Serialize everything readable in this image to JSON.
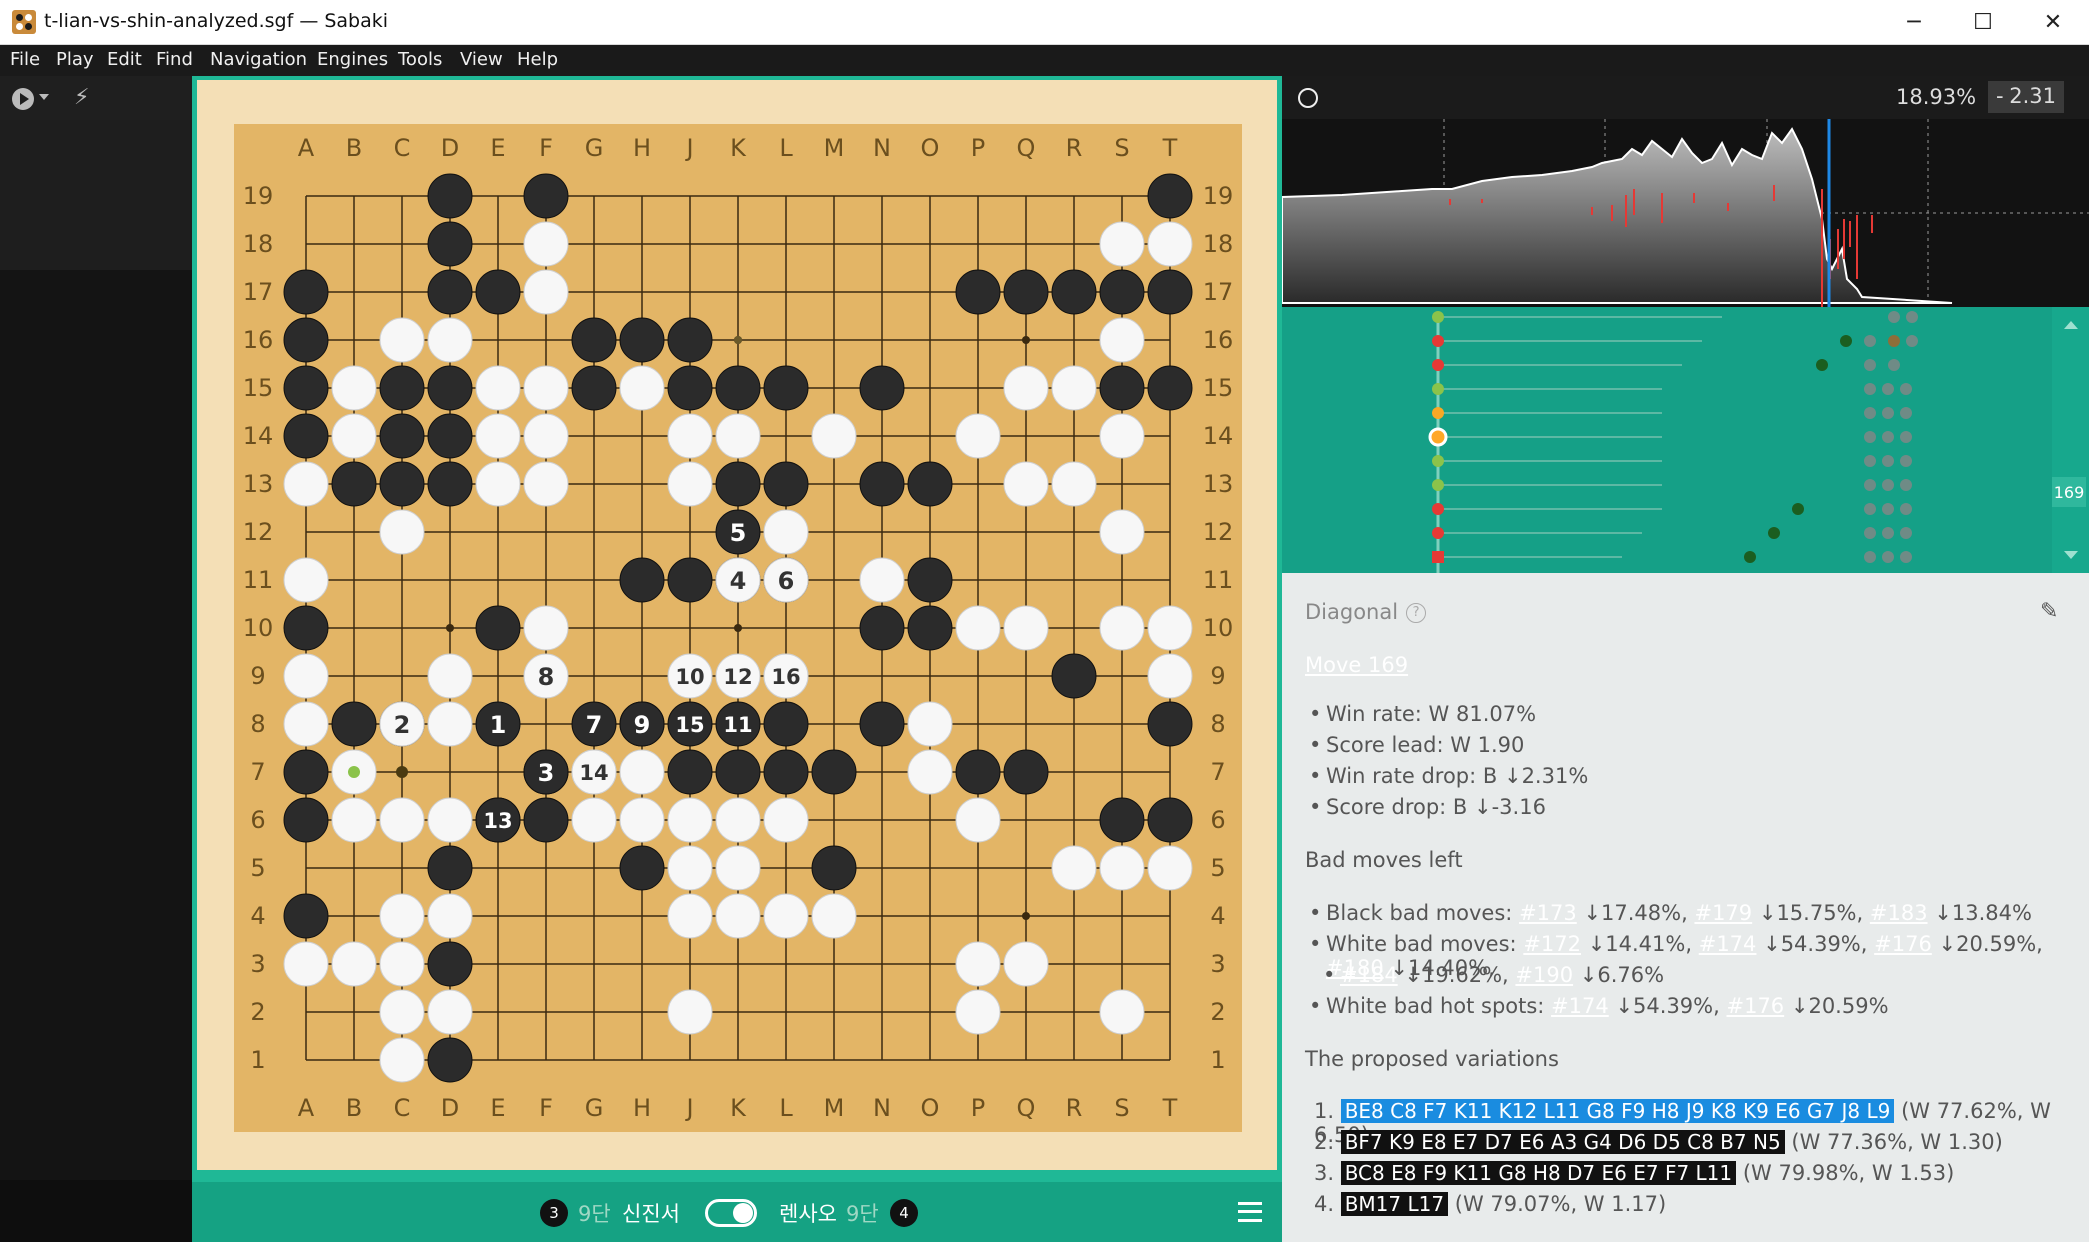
{
  "window": {
    "title": "t-lian-vs-shin-analyzed.sgf — Sabaki",
    "minimize": "─",
    "maximize": "☐",
    "close": "✕"
  },
  "menu": [
    "File",
    "Play",
    "Edit",
    "Find",
    "Navigation",
    "Engines",
    "Tools",
    "View",
    "Help"
  ],
  "toolbar": {
    "play_icon": "play-icon",
    "bolt_icon": "⚡"
  },
  "board": {
    "columns": [
      "A",
      "B",
      "C",
      "D",
      "E",
      "F",
      "G",
      "H",
      "J",
      "K",
      "L",
      "M",
      "N",
      "O",
      "P",
      "Q",
      "R",
      "S",
      "T"
    ],
    "rows": [
      "19",
      "18",
      "17",
      "16",
      "15",
      "14",
      "13",
      "12",
      "11",
      "10",
      "9",
      "8",
      "7",
      "6",
      "5",
      "4",
      "3",
      "2",
      "1"
    ],
    "stones": [
      "...B.B............B",
      "...B.W...........WW",
      "B..BBW........BBBBB",
      "B.WW..BBB........W.",
      "BWBBWWBWBBB.B..WWBB",
      "BWBBWW..WW.W..W..W.",
      "WBBBWW..WBB.BB.WW..",
      "..W......WW......W.",
      "W......BBBB.WB.....",
      "B...BW......BBWW.WW",
      "W..W......W.....B.W",
      "WBBWW..B..B.BW....B",
      "BW...BWWBBBB.WBB...",
      "BWWWBBWWWWW...W..BB",
      "...B...BWW.B....WWW",
      "B.WW....WWWW.......",
      "WWWB..........WW...",
      "..WW....W.....W..W.",
      "..WB..............."
    ],
    "numbered": [
      {
        "n": "1",
        "col": "E",
        "row": "8",
        "color": "B"
      },
      {
        "n": "2",
        "col": "C",
        "row": "8",
        "color": "W"
      },
      {
        "n": "3",
        "col": "F",
        "row": "7",
        "color": "B"
      },
      {
        "n": "4",
        "col": "K",
        "row": "11",
        "color": "W"
      },
      {
        "n": "5",
        "col": "K",
        "row": "12",
        "color": "B"
      },
      {
        "n": "6",
        "col": "L",
        "row": "11",
        "color": "W"
      },
      {
        "n": "7",
        "col": "G",
        "row": "8",
        "color": "B"
      },
      {
        "n": "8",
        "col": "F",
        "row": "9",
        "color": "W"
      },
      {
        "n": "9",
        "col": "H",
        "row": "8",
        "color": "B"
      },
      {
        "n": "10",
        "col": "J",
        "row": "9",
        "color": "W"
      },
      {
        "n": "11",
        "col": "K",
        "row": "8",
        "color": "B"
      },
      {
        "n": "12",
        "col": "K",
        "row": "9",
        "color": "W"
      },
      {
        "n": "13",
        "col": "E",
        "row": "6",
        "color": "B"
      },
      {
        "n": "14",
        "col": "G",
        "row": "7",
        "color": "W"
      },
      {
        "n": "15",
        "col": "J",
        "row": "8",
        "color": "B"
      },
      {
        "n": "16",
        "col": "L",
        "row": "9",
        "color": "W"
      }
    ]
  },
  "footer": {
    "black_captures": "3",
    "black_rank": "9단",
    "black_name": "신진서",
    "white_name": "렌사오",
    "white_rank": "9단",
    "white_captures": "4"
  },
  "analysis": {
    "winrate": "18.93%",
    "score_sign": "-",
    "score": "2.31"
  },
  "tree": {
    "move_counter": "169"
  },
  "comment": {
    "title": "Diagonal",
    "move_link": "Move 169",
    "stats": [
      "Win rate: W 81.07%",
      "Score lead: W 1.90",
      "Win rate drop: B ↓2.31%",
      "Score drop: B ↓-3.16"
    ],
    "bad_moves_heading": "Bad moves left",
    "black_label": "Black bad moves:",
    "black_moves": [
      {
        "m": "#173",
        "d": "↓17.48%"
      },
      {
        "m": "#179",
        "d": "↓15.75%"
      },
      {
        "m": "#183",
        "d": "↓13.84%"
      }
    ],
    "white_label": "White bad moves:",
    "white_moves_1": [
      {
        "m": "#172",
        "d": "↓14.41%"
      },
      {
        "m": "#174",
        "d": "↓54.39%"
      },
      {
        "m": "#176",
        "d": "↓20.59%"
      },
      {
        "m": "#180",
        "d": "↓14.40%"
      }
    ],
    "white_moves_2": [
      {
        "m": "#184",
        "d": "↓19.62%"
      },
      {
        "m": "#190",
        "d": "↓6.76%"
      }
    ],
    "hot_label": "White bad hot spots:",
    "hot_moves": [
      {
        "m": "#174",
        "d": "↓54.39%"
      },
      {
        "m": "#176",
        "d": "↓20.59%"
      }
    ],
    "variations_heading": "The proposed variations",
    "variations": [
      {
        "n": "1.",
        "moves": "BE8 C8 F7 K11 K12 L11 G8 F9 H8 J9 K8 K9 E6 G7 J8 L9",
        "stats": "(W 77.62%, W 6.50)",
        "selected": true
      },
      {
        "n": "2.",
        "moves": "BF7 K9 E8 E7 D7 E6 A3 G4 D6 D5 C8 B7 N5",
        "stats": "(W 77.36%, W 1.30)",
        "selected": false
      },
      {
        "n": "3.",
        "moves": "BC8 E8 F9 K11 G8 H8 D7 E6 E7 F7 L11",
        "stats": "(W 79.98%, W 1.53)",
        "selected": false
      },
      {
        "n": "4.",
        "moves": "BM17 L17",
        "stats": "(W 79.07%, W 1.17)",
        "selected": false
      }
    ]
  },
  "colors": {
    "accent": "#1fb896",
    "board": "#e3b566",
    "selected_variation": "#1a8ce0"
  }
}
